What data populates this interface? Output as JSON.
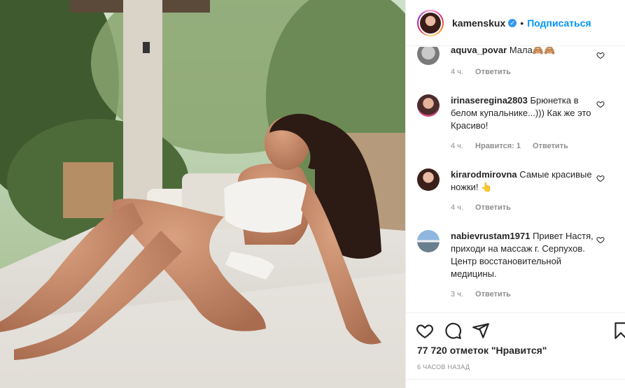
{
  "post": {
    "username": "kamenskux",
    "separator": "•",
    "follow_label": "Подписаться",
    "verified_mark": "✓"
  },
  "comments": [
    {
      "user": "aquva_povar",
      "text": "Мала🙈🙈",
      "time": "4 ч.",
      "likes": "",
      "reply": "Ответить"
    },
    {
      "user": "irinaseregina2803",
      "text": "Брюнетка в белом купальнике...))) Как же это Красиво!",
      "time": "4 ч.",
      "likes": "Нравится: 1",
      "reply": "Ответить"
    },
    {
      "user": "kirarodmirovna",
      "text": "Самые красивые ножки! 👆",
      "time": "4 ч.",
      "likes": "",
      "reply": "Ответить"
    },
    {
      "user": "nabievrustam1971",
      "text": "Привет Настя, приходи на массаж г. Серпухов. Центр восстановительной медицины.",
      "time": "3 ч.",
      "likes": "",
      "reply": "Ответить"
    }
  ],
  "footer": {
    "likes_text": "77 720 отметок \"Нравится\"",
    "posted_ago": "6 ЧАСОВ НАЗАД"
  },
  "icons": [
    "heart-icon",
    "comment-icon",
    "share-icon",
    "bookmark-icon",
    "verified-icon"
  ],
  "colors": {
    "accent": "#0095f6",
    "muted": "#8e8e8e",
    "text": "#262626",
    "border": "#efefef"
  }
}
